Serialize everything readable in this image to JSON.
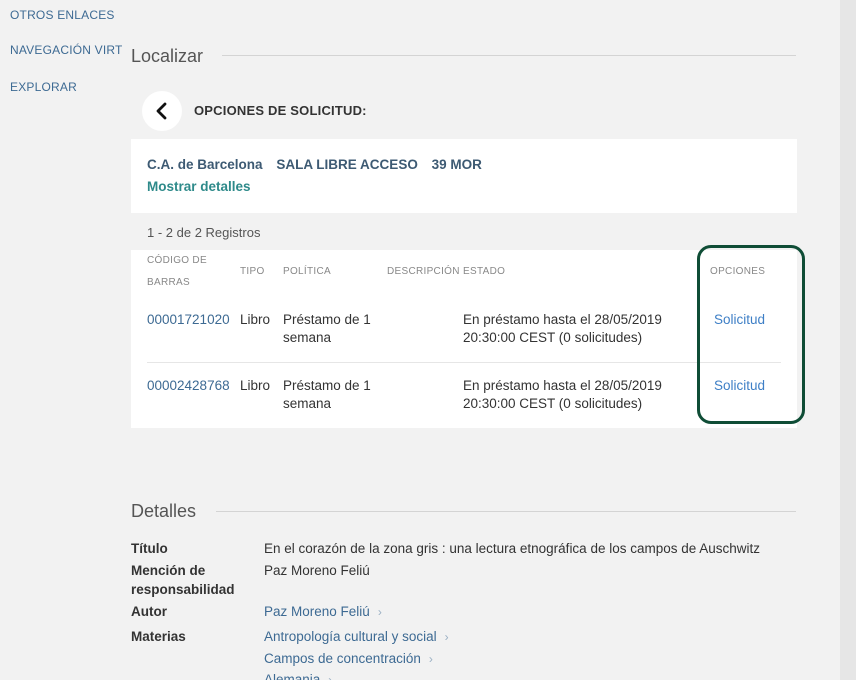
{
  "sidenav": {
    "items": [
      "OTROS ENLACES",
      "NAVEGACIÓN VIRTUAL",
      "EXPLORAR"
    ]
  },
  "locate": {
    "title": "Localizar",
    "request_options_title": "OPCIONES DE SOLICITUD:",
    "location": {
      "library": "C.A. de Barcelona",
      "collection": "SALA LIBRE ACCESO",
      "call_number": "39 MOR"
    },
    "show_details": "Mostrar detalles",
    "records_count": "1 - 2 de 2 Registros",
    "table": {
      "headers": {
        "barcode_line1": "CÓDIGO DE",
        "barcode_line2": "BARRAS",
        "type": "TIPO",
        "policy": "POLÍTICA",
        "description": "DESCRIPCIÓN",
        "status": "ESTADO",
        "options": "OPCIONES"
      },
      "rows": [
        {
          "barcode": "00001721020",
          "type": "Libro",
          "policy_line1": "Préstamo de 1",
          "policy_line2": "semana",
          "description": "",
          "status_line1": "En préstamo hasta el 28/05/2019",
          "status_line2": "20:30:00 CEST (0 solicitudes)",
          "option": "Solicitud"
        },
        {
          "barcode": "00002428768",
          "type": "Libro",
          "policy_line1": "Préstamo de 1",
          "policy_line2": "semana",
          "description": "",
          "status_line1": "En préstamo hasta el 28/05/2019",
          "status_line2": "20:30:00 CEST (0 solicitudes)",
          "option": "Solicitud"
        }
      ]
    }
  },
  "details": {
    "title": "Detalles",
    "fields": {
      "title_label": "Título",
      "title_value": "En el corazón de la zona gris : una lectura etnográfica de los campos de Auschwitz",
      "responsibility_label_line1": "Mención de",
      "responsibility_label_line2": "responsabilidad",
      "responsibility_value": "Paz Moreno Feliú",
      "author_label": "Autor",
      "author_value": "Paz Moreno Feliú",
      "subjects_label": "Materias",
      "subjects": [
        "Antropología cultural y social",
        "Campos de concentración",
        "Alemania"
      ]
    }
  },
  "icons": {
    "back": "chevron-left-icon",
    "link_arrow": "chevron-right-icon"
  },
  "colors": {
    "link": "#3d6a93",
    "action_link": "#3e7fc6",
    "teal_link": "#2e8a8a",
    "highlight_border": "#0f4d36",
    "page_bg": "#f2f2f2"
  }
}
